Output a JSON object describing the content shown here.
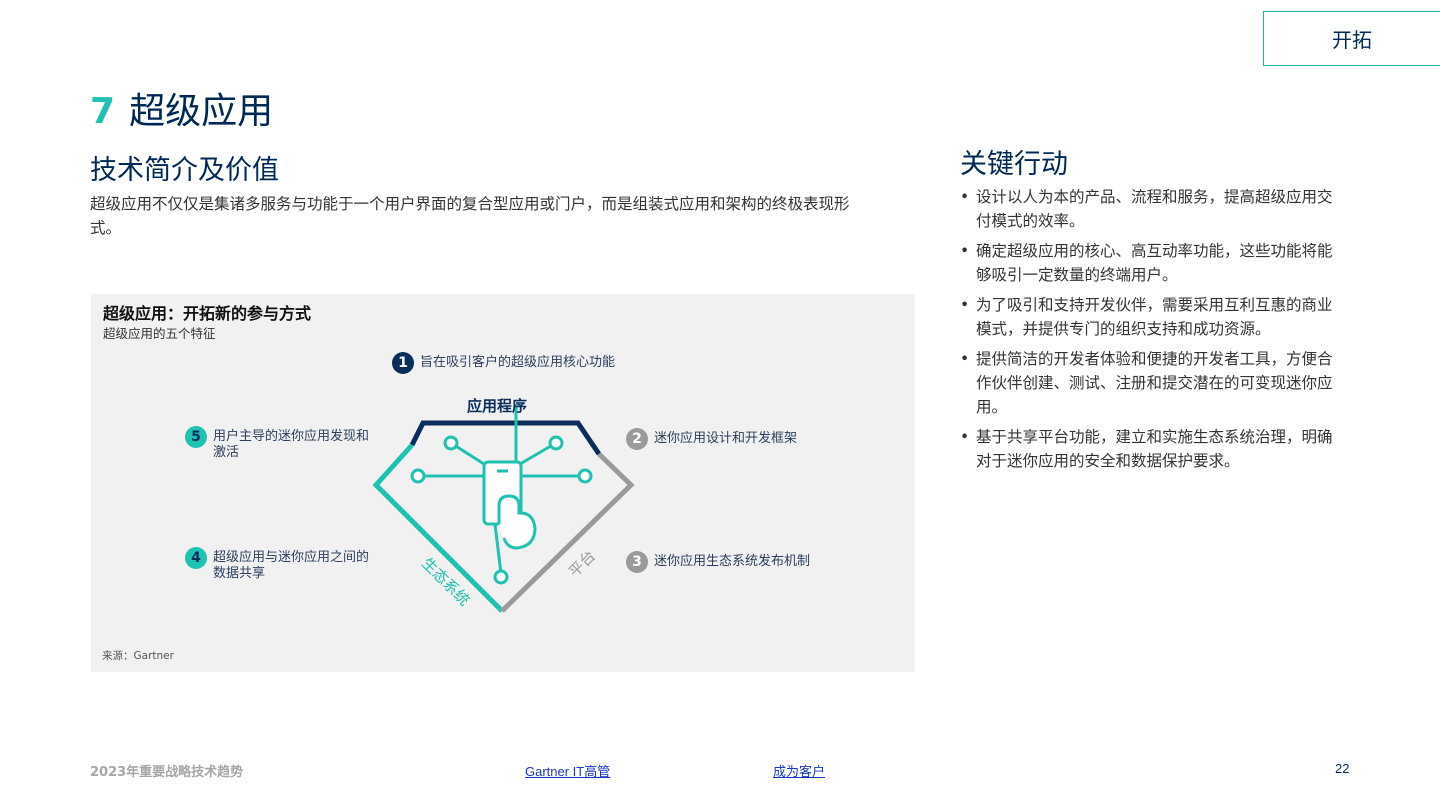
{
  "top_tab": "开拓",
  "title": {
    "number": "7",
    "text": "超级应用"
  },
  "left_section": {
    "heading": "技术简介及价值",
    "body": "超级应用不仅仅是集诸多服务与功能于一个用户界面的复合型应用或门户，而是组装式应用和架构的终极表现形式。"
  },
  "figure": {
    "title": "超级应用：开拓新的参与方式",
    "subtitle": "超级应用的五个特征",
    "diagram_labels": {
      "top": "应用程序",
      "left": "生态系统",
      "right": "平台"
    },
    "features": [
      {
        "num": "1",
        "text": "旨在吸引客户的超级应用核心功能"
      },
      {
        "num": "2",
        "text": "迷你应用设计和开发框架"
      },
      {
        "num": "3",
        "text": "迷你应用生态系统发布机制"
      },
      {
        "num": "4",
        "text": "超级应用与迷你应用之间的数据共享"
      },
      {
        "num": "5",
        "text": "用户主导的迷你应用发现和激活"
      }
    ],
    "source": "来源：Gartner",
    "colors": {
      "navy": "#0a2d5a",
      "teal": "#1fc1b1",
      "gray": "#9a9a9a"
    }
  },
  "right_section": {
    "heading": "关键行动",
    "actions": [
      "设计以人为本的产品、流程和服务，提高超级应用交付模式的效率。",
      "确定超级应用的核心、高互动率功能，这些功能将能够吸引一定数量的终端用户。",
      "为了吸引和支持开发伙伴，需要采用互利互惠的商业模式，并提供专门的组织支持和成功资源。",
      "提供简洁的开发者体验和便捷的开发者工具，方便合作伙伴创建、测试、注册和提交潜在的可变现迷你应用。",
      "基于共享平台功能，建立和实施生态系统治理，明确对于迷你应用的安全和数据保护要求。"
    ]
  },
  "footer": {
    "doc_title": "2023年重要战略技术趋势",
    "link1": "Gartner IT高管",
    "link2": "成为客户",
    "page": "22"
  }
}
